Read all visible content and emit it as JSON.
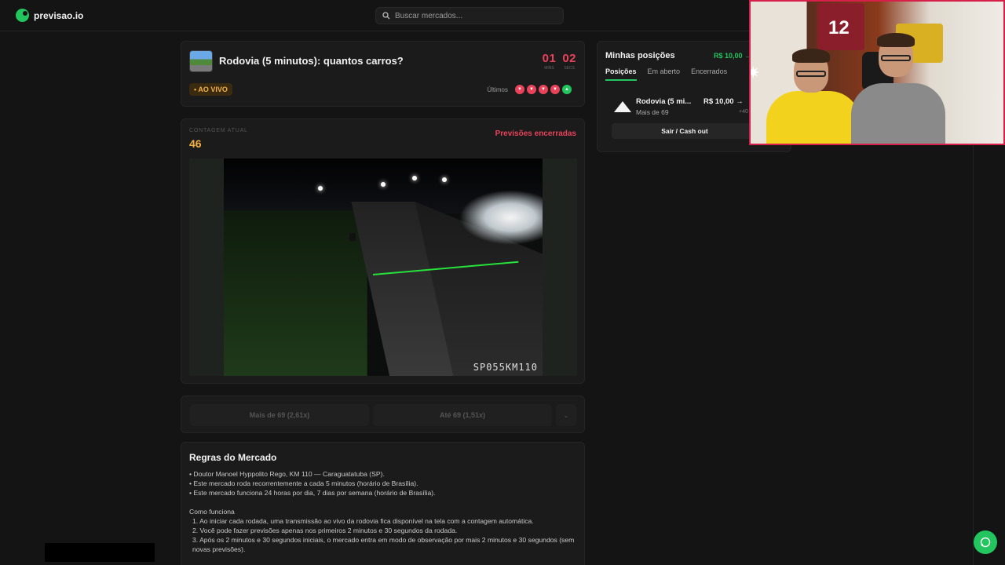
{
  "topbar": {
    "logo": "previsao.io",
    "search_placeholder": "Buscar mercados..."
  },
  "market": {
    "title": "Rodovia (5 minutos): quantos carros?",
    "timer": [
      {
        "value": "01",
        "label": "MINS"
      },
      {
        "value": "02",
        "label": "SECS"
      }
    ],
    "live_badge": "• AO VIVO",
    "last_label": "Últimos",
    "last_results": [
      "down",
      "down",
      "down",
      "down",
      "up"
    ]
  },
  "count": {
    "label": "CONTAGEM ATUAL",
    "value": "46",
    "status": "Previsões encerradas",
    "camera_tag": "SP055KM110"
  },
  "bets": {
    "option1": "Mais de 69 (2,61x)",
    "option2": "Até 69 (1,51x)"
  },
  "rules": {
    "title": "Regras do Mercado",
    "lines": [
      "• Doutor Manoel Hyppolito Rego, KM 110 — Caraguatatuba (SP).",
      "• Este mercado roda recorrentemente a cada 5 minutos (horário de Brasília).",
      "• Este mercado funciona 24 horas por dia, 7 dias por semana (horário de Brasília)."
    ],
    "how_title": "Como funciona",
    "steps": [
      "1. Ao iniciar cada rodada, uma transmissão ao vivo da rodovia fica disponível na tela com a contagem automática.",
      "2. Você pode fazer previsões apenas nos primeiros 2 minutos e 30 segundos da rodada.",
      "3. Após os 2 minutos e 30 segundos iniciais, o mercado entra em modo de observação por mais 2 minutos e 30 segundos (sem novas previsões)."
    ]
  },
  "positions": {
    "title": "Minhas posições",
    "amount": "R$ 10,00 →",
    "tabs": [
      "Posições",
      "Em aberto",
      "Encerrados"
    ],
    "item": {
      "name": "Rodovia (5 mi...",
      "sub": "Mais de 69",
      "value": "R$ 10,00 →",
      "delta": "+40"
    },
    "cashout": "Sair / Cash out"
  },
  "webcam": {
    "jersey_number": "12"
  },
  "colors": {
    "accent_green": "#22c55e",
    "accent_red": "#e8435a",
    "accent_orange": "#f5b042"
  }
}
